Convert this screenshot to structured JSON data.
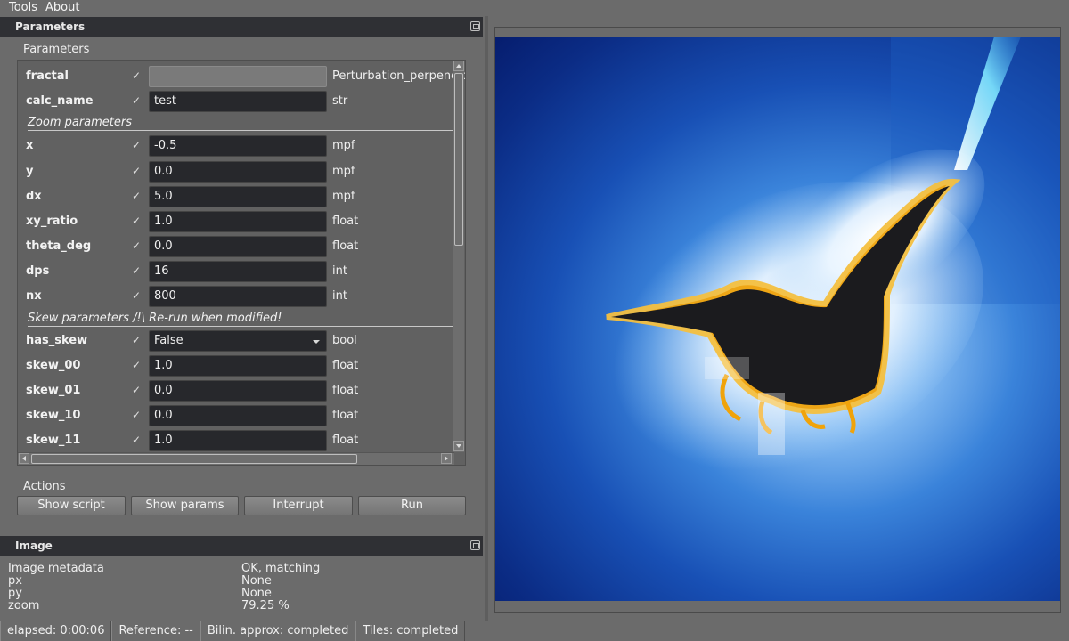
{
  "menu": {
    "items": [
      "Tools",
      "About"
    ]
  },
  "params_dock": {
    "title": "Parameters",
    "group_label": "Parameters",
    "rows": [
      {
        "kind": "param",
        "name": "fractal",
        "checked": true,
        "value": "",
        "type": "Perturbation_perpendicular",
        "field": "grey"
      },
      {
        "kind": "param",
        "name": "calc_name",
        "checked": true,
        "value": "test",
        "type": "str",
        "field": "text"
      },
      {
        "kind": "section",
        "label": "Zoom parameters"
      },
      {
        "kind": "param",
        "name": "x",
        "checked": true,
        "value": "-0.5",
        "type": "mpf",
        "field": "text"
      },
      {
        "kind": "param",
        "name": "y",
        "checked": true,
        "value": "0.0",
        "type": "mpf",
        "field": "text"
      },
      {
        "kind": "param",
        "name": "dx",
        "checked": true,
        "value": "5.0",
        "type": "mpf",
        "field": "text"
      },
      {
        "kind": "param",
        "name": "xy_ratio",
        "checked": true,
        "value": "1.0",
        "type": "float",
        "field": "text"
      },
      {
        "kind": "param",
        "name": "theta_deg",
        "checked": true,
        "value": "0.0",
        "type": "float",
        "field": "text"
      },
      {
        "kind": "param",
        "name": "dps",
        "checked": true,
        "value": "16",
        "type": "int",
        "field": "text"
      },
      {
        "kind": "param",
        "name": "nx",
        "checked": true,
        "value": "800",
        "type": "int",
        "field": "text"
      },
      {
        "kind": "section",
        "label": "Skew parameters /!\\ Re-run when modified!"
      },
      {
        "kind": "param",
        "name": "has_skew",
        "checked": true,
        "value": "False",
        "type": "bool",
        "field": "combo"
      },
      {
        "kind": "param",
        "name": "skew_00",
        "checked": true,
        "value": "1.0",
        "type": "float",
        "field": "text"
      },
      {
        "kind": "param",
        "name": "skew_01",
        "checked": true,
        "value": "0.0",
        "type": "float",
        "field": "text"
      },
      {
        "kind": "param",
        "name": "skew_10",
        "checked": true,
        "value": "0.0",
        "type": "float",
        "field": "text"
      },
      {
        "kind": "param",
        "name": "skew_11",
        "checked": true,
        "value": "1.0",
        "type": "float",
        "field": "text"
      }
    ],
    "actions_label": "Actions",
    "buttons": {
      "show_script": "Show script",
      "show_params": "Show params",
      "interrupt": "Interrupt",
      "run": "Run"
    }
  },
  "image_dock": {
    "title": "Image",
    "metadata": [
      {
        "key": "Image metadata",
        "value": "OK, matching"
      },
      {
        "key": "px",
        "value": "None"
      },
      {
        "key": "py",
        "value": "None"
      },
      {
        "key": "zoom",
        "value": "79.25 %"
      }
    ]
  },
  "status": {
    "elapsed": "elapsed: 0:00:06",
    "reference": "Reference: --",
    "bilin": "Bilin. approx: completed",
    "tiles": "Tiles: completed"
  },
  "colors": {
    "dock_title_bg": "#2f3034",
    "field_bg": "#27282c",
    "panel_bg": "#6b6b6b",
    "fractal_gold": "#f0a30a",
    "fractal_blue": "#1850b5"
  }
}
